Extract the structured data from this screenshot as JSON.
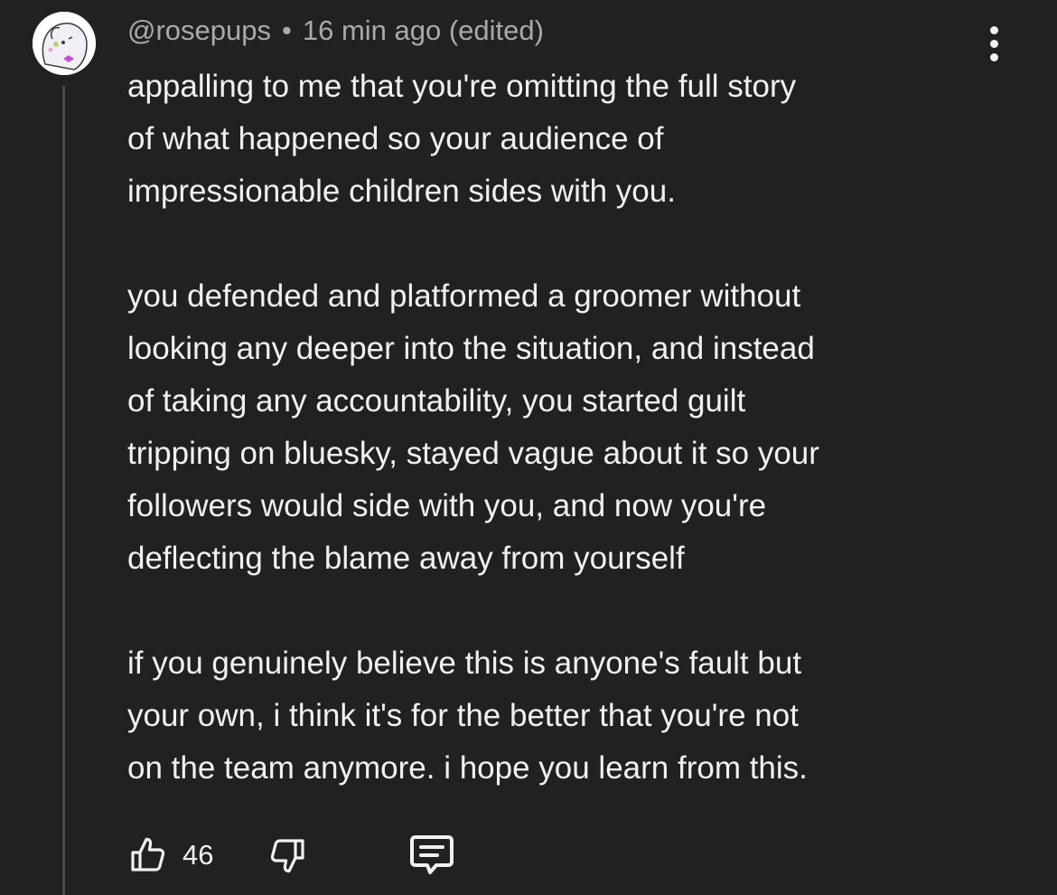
{
  "comment": {
    "author": "@rosepups",
    "separator": "•",
    "timestamp": "16 min ago (edited)",
    "paragraphs": [
      "appalling to me that you're omitting the full story\nof what happened so your audience of\nimpressionable children sides with you.",
      "you defended and platformed a groomer without\nlooking any deeper into the situation, and instead\nof taking any accountability, you started guilt\ntripping on bluesky, stayed vague about it so your\nfollowers would side with you, and now you're\ndeflecting the blame away from yourself",
      "if you genuinely believe this is anyone's fault but\nyour own, i think it's for the better that you're not\non the team anymore. i hope you learn from this."
    ],
    "like_count": "46"
  },
  "icons": {
    "more": "more-vertical-icon",
    "like": "thumbs-up-icon",
    "dislike": "thumbs-down-icon",
    "reply": "reply-comment-icon"
  },
  "colors": {
    "background": "#212121",
    "text": "#f1f1f1",
    "meta_text": "#aaaaaa",
    "thread_line": "#4a4a4a"
  }
}
